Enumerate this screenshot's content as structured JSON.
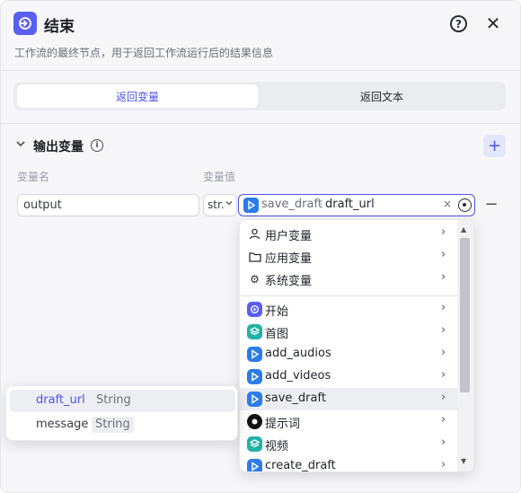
{
  "header": {
    "title": "结束",
    "subtitle": "工作流的最终节点，用于返回工作流运行后的结果信息",
    "icon": "end-node-icon",
    "accent": "#5a5ff0"
  },
  "tabs": [
    {
      "label": "返回变量",
      "active": true
    },
    {
      "label": "返回文本",
      "active": false
    }
  ],
  "output": {
    "section_title": "输出变量",
    "col_name": "变量名",
    "col_value": "变量值",
    "row": {
      "name": "output",
      "type": "str.",
      "ref_node": "save_draft",
      "ref_sep": "-",
      "ref_field": "draft_url",
      "clear": "×"
    }
  },
  "dropdown": {
    "items": [
      {
        "label": "用户变量",
        "icon": "user-icon"
      },
      {
        "label": "应用变量",
        "icon": "folder-icon"
      },
      {
        "label": "系统变量",
        "icon": "gear-icon"
      },
      {
        "label": "开始",
        "icon": "start-node-icon",
        "color": "#5a5ff0"
      },
      {
        "label": "首图",
        "icon": "layers-icon",
        "color": "#20b2a6"
      },
      {
        "label": "add_audios",
        "icon": "plugin-icon",
        "color": "#2b7ce9"
      },
      {
        "label": "add_videos",
        "icon": "plugin-icon",
        "color": "#2b7ce9"
      },
      {
        "label": "save_draft",
        "icon": "plugin-icon",
        "color": "#2b7ce9",
        "highlighted": true
      },
      {
        "label": "提示词",
        "icon": "llm-icon",
        "color": "#111111"
      },
      {
        "label": "视频",
        "icon": "layers-icon",
        "color": "#20b2a6"
      },
      {
        "label": "create_draft",
        "icon": "plugin-icon",
        "color": "#2b7ce9"
      }
    ]
  },
  "fields_popup": {
    "items": [
      {
        "name": "draft_url",
        "type": "String",
        "highlighted": true,
        "color": "#4d53e8"
      },
      {
        "name": "message",
        "type": "String",
        "highlighted": false,
        "color": "#3a3d44"
      }
    ]
  }
}
